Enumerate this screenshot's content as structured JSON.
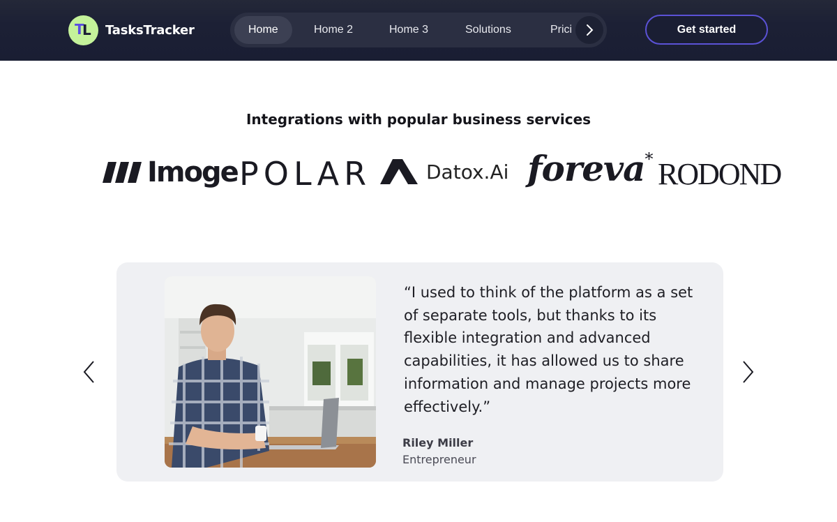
{
  "header": {
    "brand_name": "TasksTracker",
    "brand_mark": "TL",
    "nav": [
      "Home",
      "Home 2",
      "Home 3",
      "Solutions",
      "Prici"
    ],
    "cta_label": "Get started",
    "nav_scroll_icon": "chevron-right-icon",
    "colors": {
      "bar": "#1a1e33",
      "brand_logo_bg": "#c4f29a",
      "accent": "#5b52d6"
    }
  },
  "integrations": {
    "title": "Integrations with popular business services",
    "logos": [
      "Imoge",
      "POLAR",
      "Datox.Ai",
      "foreva",
      "RODOND"
    ]
  },
  "testimonial": {
    "quote": "“I used to think of the platform as a set of separate tools, but thanks to its flexible integration and advanced capabilities, it has allowed us to share information and manage projects more effectively.”",
    "author": "Riley Miller",
    "role": "Entrepreneur",
    "prev_icon": "chevron-left-icon",
    "next_icon": "chevron-right-icon",
    "card_bg": "#eff0f3"
  }
}
